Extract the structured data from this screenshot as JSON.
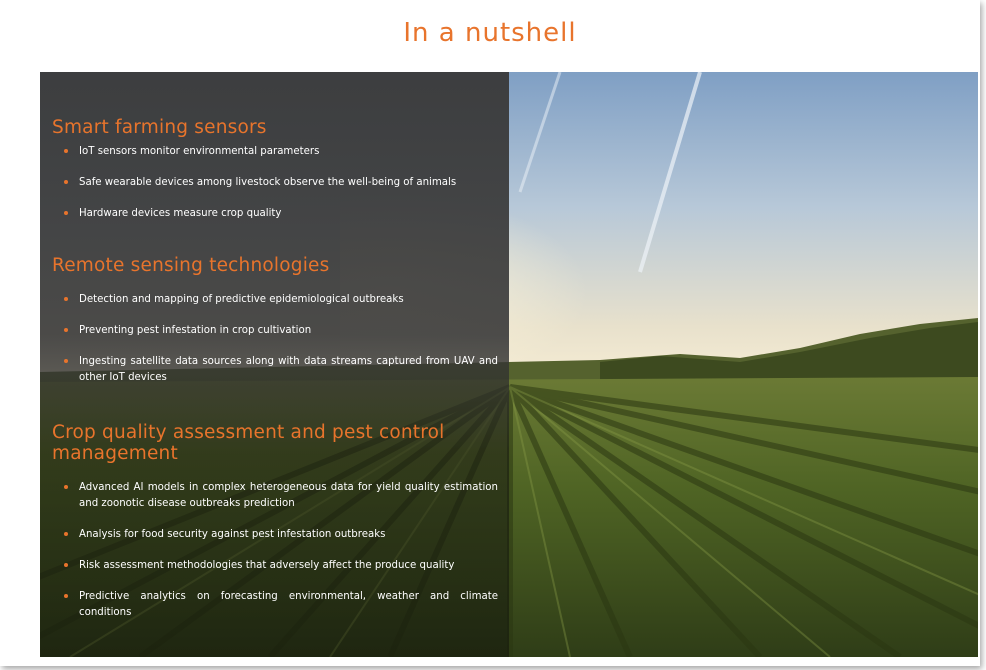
{
  "title": "In a nutshell",
  "sections": [
    {
      "heading": "Smart farming sensors",
      "items": [
        "IoT sensors monitor environmental parameters",
        "Safe wearable devices among livestock observe the well-being of animals",
        "Hardware devices measure crop quality"
      ]
    },
    {
      "heading": "Remote sensing technologies",
      "items": [
        "Detection and mapping of predictive epidemiological outbreaks",
        "Preventing pest infestation in crop cultivation",
        "Ingesting satellite data sources along with data streams captured from UAV and other IoT devices"
      ]
    },
    {
      "heading": "Crop quality assessment and pest control management",
      "items": [
        "Advanced AI models in complex heterogeneous data for yield quality estimation and zoonotic disease outbreaks prediction",
        "Analysis for food security against pest infestation outbreaks",
        "Risk assessment methodologies that adversely affect the produce quality",
        "Predictive analytics on forecasting environmental, weather and climate conditions"
      ]
    }
  ],
  "colors": {
    "accent": "#e8742c",
    "overlay": "#3a3a3a",
    "text": "#ffffff"
  },
  "background_image": "farm-field-sunset-photo"
}
